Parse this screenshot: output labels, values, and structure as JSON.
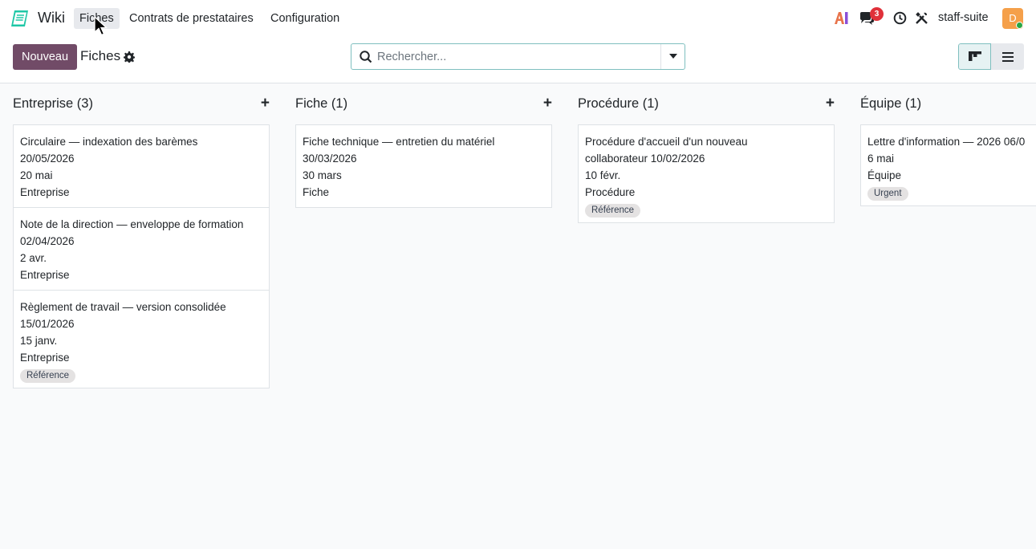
{
  "app": {
    "name": "Wiki",
    "menu": [
      {
        "label": "Fiches",
        "active": true
      },
      {
        "label": "Contrats de prestataires",
        "active": false
      },
      {
        "label": "Configuration",
        "active": false
      }
    ],
    "notifications_count": "3",
    "ai_label": "AI",
    "username": "staff-suite",
    "avatar_letter": "D"
  },
  "control": {
    "new_button": "Nouveau",
    "title": "Fiches",
    "search_placeholder": "Rechercher..."
  },
  "columns": [
    {
      "title": "Entreprise (3)",
      "cards": [
        {
          "lines": [
            "Circulaire — indexation des barèmes",
            "20/05/2026",
            "20 mai",
            "Entreprise"
          ],
          "tag": ""
        },
        {
          "lines": [
            "Note de la direction — enveloppe de formation",
            "02/04/2026",
            "2 avr.",
            "Entreprise"
          ],
          "tag": ""
        },
        {
          "lines": [
            "Règlement de travail — version consolidée",
            "15/01/2026",
            "15 janv.",
            "Entreprise"
          ],
          "tag": "Référence"
        }
      ]
    },
    {
      "title": "Fiche (1)",
      "cards": [
        {
          "lines": [
            "Fiche technique — entretien du matériel",
            "30/03/2026",
            "30 mars",
            "Fiche"
          ],
          "tag": ""
        }
      ]
    },
    {
      "title": "Procédure (1)",
      "cards": [
        {
          "lines": [
            "Procédure d'accueil d'un nouveau",
            "collaborateur 10/02/2026",
            "10 févr.",
            "Procédure"
          ],
          "tag": "Référence"
        }
      ]
    },
    {
      "title": "Équipe (1)",
      "cards": [
        {
          "lines": [
            "Lettre d'information — 2026 06/0",
            "6 mai",
            "Équipe"
          ],
          "tag": "Urgent"
        }
      ]
    }
  ],
  "colors": {
    "primary": "#714b67",
    "accent": "#7fbfbf",
    "badge": "#e0313a",
    "avatar": "#f5a04a"
  }
}
